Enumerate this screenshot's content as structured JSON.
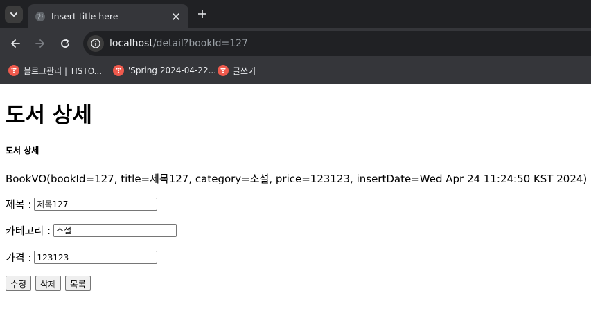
{
  "browser": {
    "tab": {
      "title": "Insert title here"
    },
    "address": {
      "host": "localhost",
      "path": "/detail?bookId=127"
    },
    "bookmarks": [
      {
        "label": "블로그관리 | TISTO..."
      },
      {
        "label": "'Spring 2024-04-22..."
      },
      {
        "label": "글쓰기"
      }
    ],
    "colors": {
      "chrome_bg": "#202124",
      "toolbar_bg": "#35363a",
      "bookmark_icon": "#ef5a4d"
    }
  },
  "page": {
    "title": "도서 상세",
    "subtitle": "도서 상세",
    "vo_text": "BookVO(bookId=127, title=제목127, category=소설, price=123123, insertDate=Wed Apr 24 11:24:50 KST 2024)",
    "fields": {
      "title": {
        "label": "제목 :",
        "value": "제목127"
      },
      "category": {
        "label": "카테고리 :",
        "value": "소설"
      },
      "price": {
        "label": "가격 :",
        "value": "123123"
      }
    },
    "buttons": {
      "edit": "수정",
      "delete": "삭제",
      "list": "목록"
    }
  }
}
